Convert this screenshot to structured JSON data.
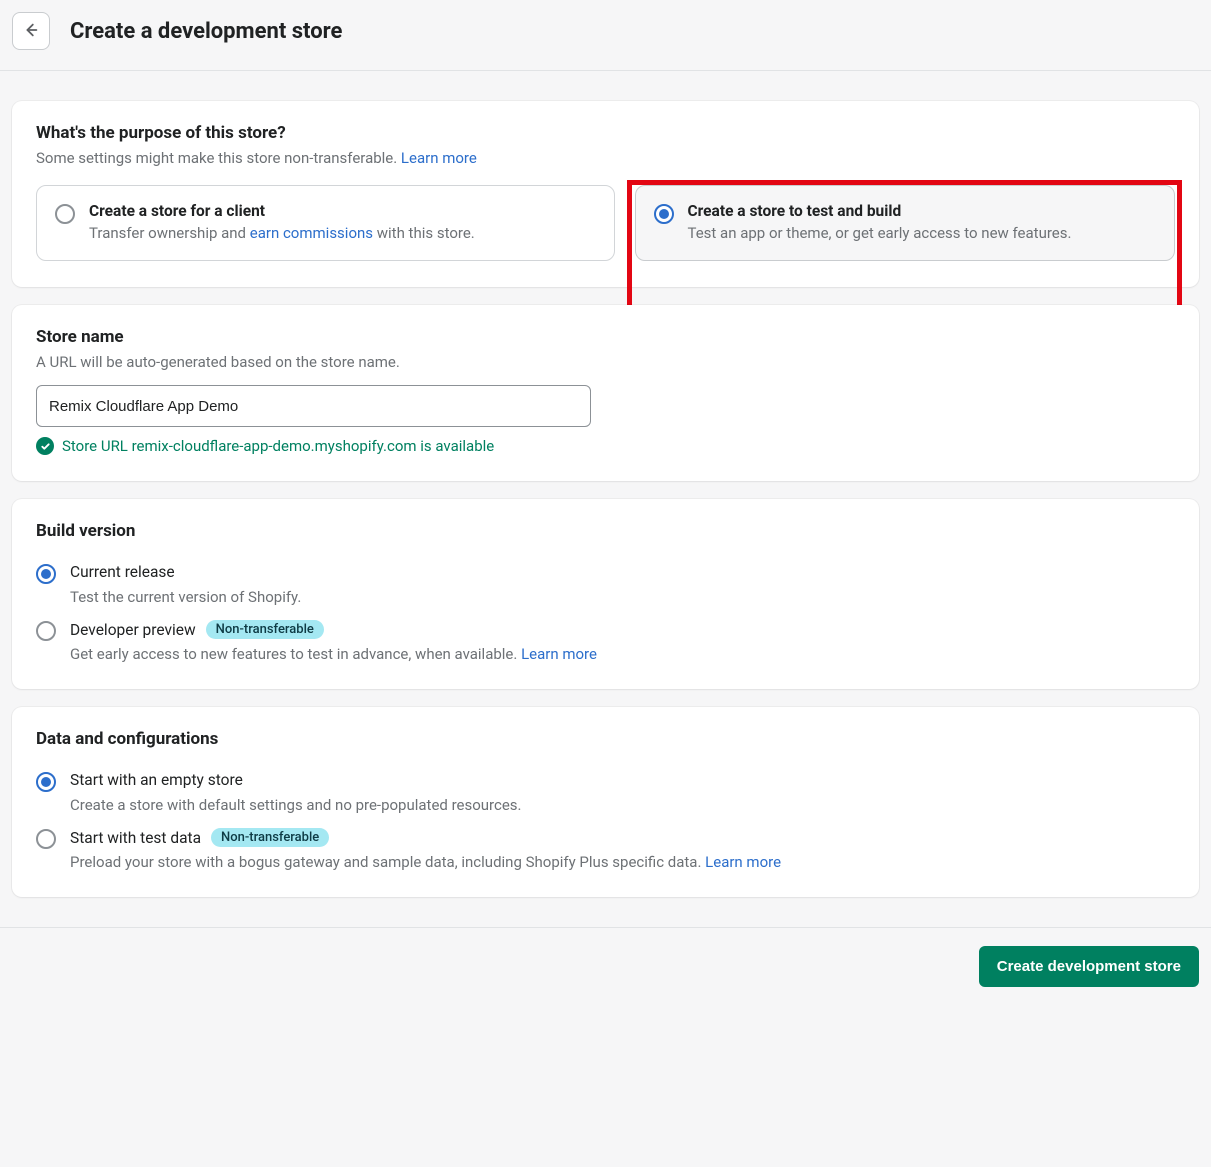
{
  "header": {
    "title": "Create a development store"
  },
  "purpose": {
    "heading": "What's the purpose of this store?",
    "subtext_prefix": "Some settings might make this store non-transferable. ",
    "learn_more": "Learn more",
    "options": {
      "client": {
        "title": "Create a store for a client",
        "desc_prefix": "Transfer ownership and ",
        "desc_link": "earn commissions",
        "desc_suffix": " with this store."
      },
      "test": {
        "title": "Create a store to test and build",
        "desc": "Test an app or theme, or get early access to new features."
      }
    }
  },
  "storeName": {
    "heading": "Store name",
    "subtext": "A URL will be auto-generated based on the store name.",
    "value": "Remix Cloudflare App Demo",
    "availability": "Store URL remix-cloudflare-app-demo.myshopify.com is available"
  },
  "buildVersion": {
    "heading": "Build version",
    "current": {
      "label": "Current release",
      "desc": "Test the current version of Shopify."
    },
    "preview": {
      "label": "Developer preview",
      "badge": "Non-transferable",
      "desc_prefix": "Get early access to new features to test in advance, when available. ",
      "learn_more": "Learn more"
    }
  },
  "dataConfig": {
    "heading": "Data and configurations",
    "empty": {
      "label": "Start with an empty store",
      "desc": "Create a store with default settings and no pre-populated resources."
    },
    "testData": {
      "label": "Start with test data",
      "badge": "Non-transferable",
      "desc_prefix": "Preload your store with a bogus gateway and sample data, including Shopify Plus specific data. ",
      "learn_more": "Learn more"
    }
  },
  "footer": {
    "submit": "Create development store"
  }
}
